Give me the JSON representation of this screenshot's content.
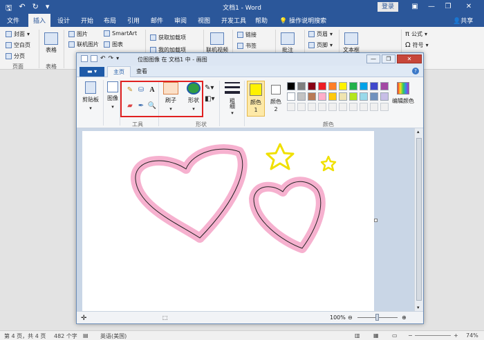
{
  "word": {
    "title": "文档1 - Word",
    "login_label": "登录",
    "tabs": [
      "文件",
      "插入",
      "设计",
      "开始",
      "布局",
      "引用",
      "邮件",
      "审阅",
      "视图",
      "开发工具",
      "帮助"
    ],
    "active_tab": "插入",
    "search_label": "操作说明搜索",
    "share_label": "共享",
    "ribbon": {
      "cover": "封面",
      "blank_page": "空白页",
      "page_break": "分页",
      "pages_group": "页面",
      "table": "表格",
      "tables_group": "表格",
      "pictures": "图片",
      "online_pictures": "联机图片",
      "smartart": "SmartArt",
      "chart": "图表",
      "get_addins": "获取加载项",
      "my_addins": "我的加载项",
      "online_video": "联机视频",
      "link": "链接",
      "bookmark": "书签",
      "comment": "批注",
      "header": "页眉",
      "footer": "页脚",
      "textbox": "文本框",
      "formula": "公式",
      "symbol": "符号"
    },
    "status": {
      "page": "第 4 页，共 4 页",
      "words": "482 个字",
      "language": "英语(美国)",
      "zoom": "74%"
    }
  },
  "paint": {
    "title": "位图图像 在 文档1 中 - 画图",
    "tabs": [
      "主页",
      "查看"
    ],
    "active_tab": "主页",
    "groups": {
      "clipboard": "剪贴板",
      "image": "图像",
      "tools": "工具",
      "brushes": "刷子",
      "shapes": "形状",
      "shapes_group": "形状",
      "size": "粗细",
      "color1": "颜色 1",
      "color2": "颜色 2",
      "colors_group": "颜色",
      "edit_colors": "编辑颜色"
    },
    "zoom": "100%",
    "palette": [
      "#000000",
      "#7f7f7f",
      "#880015",
      "#ed1c24",
      "#ff7f27",
      "#fff200",
      "#22b14c",
      "#00a2e8",
      "#3f48cc",
      "#a349a4",
      "#ffffff",
      "#c3c3c3",
      "#b97a57",
      "#ffaec9",
      "#ffc90e",
      "#efe4b0",
      "#b5e61d",
      "#99d9ea",
      "#7092be",
      "#c8bfe7"
    ],
    "color1_value": "#fff200",
    "color2_value": "#ffffff",
    "hearts_color": "#f5a3c7",
    "stars_color": "#f0e000"
  }
}
